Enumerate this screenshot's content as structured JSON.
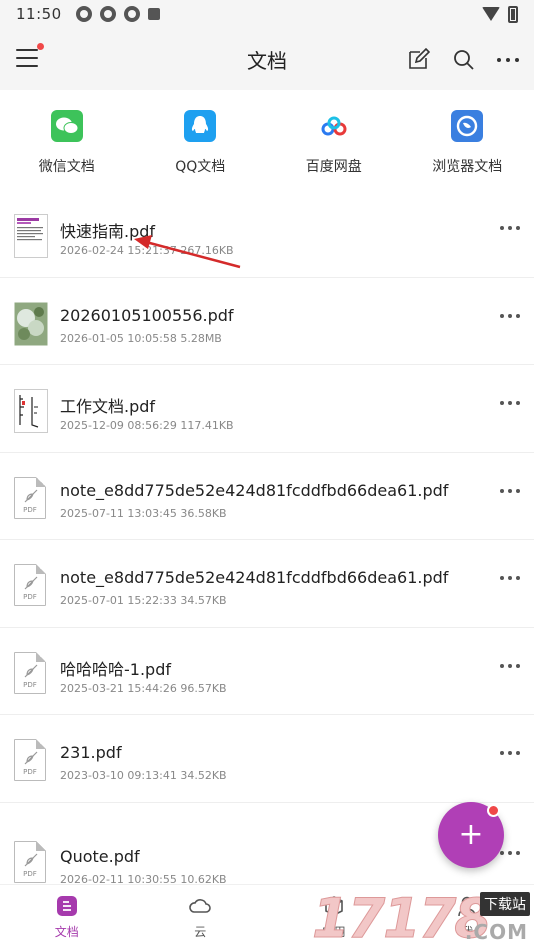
{
  "status": {
    "time": "11:50"
  },
  "header": {
    "title": "文档"
  },
  "sources": [
    {
      "label": "微信文档",
      "icon": "wechat-icon",
      "color": "#3dc35a"
    },
    {
      "label": "QQ文档",
      "icon": "qq-icon",
      "color": "#1ea0f0"
    },
    {
      "label": "百度网盘",
      "icon": "baidu-netdisk-icon",
      "color": "#2b7af0"
    },
    {
      "label": "浏览器文档",
      "icon": "browser-icon",
      "color": "#3a7fe0"
    }
  ],
  "files": [
    {
      "name": "快速指南.pdf",
      "meta": "2026-02-24 15:21:37 267.16KB",
      "thumb": "doc-preview"
    },
    {
      "name": "20260105100556.pdf",
      "meta": "2026-01-05 10:05:58 5.28MB",
      "thumb": "photo-preview"
    },
    {
      "name": "工作文档.pdf",
      "meta": "2025-12-09 08:56:29 117.41KB",
      "thumb": "doc-preview-2"
    },
    {
      "name": "note_e8dd775de52e424d81fcddfbd66dea61.pdf",
      "meta": "2025-07-11 13:03:45 36.58KB",
      "thumb": "pdf-icon"
    },
    {
      "name": "note_e8dd775de52e424d81fcddfbd66dea61.pdf",
      "meta": "2025-07-01 15:22:33 34.57KB",
      "thumb": "pdf-icon"
    },
    {
      "name": "哈哈哈哈-1.pdf",
      "meta": "2025-03-21 15:44:26 96.57KB",
      "thumb": "pdf-icon"
    },
    {
      "name": "231.pdf",
      "meta": "2023-03-10 09:13:41 34.52KB",
      "thumb": "pdf-icon"
    },
    {
      "name": "Quote.pdf",
      "meta": "2026-02-11 10:30:55 10.62KB",
      "thumb": "pdf-icon"
    }
  ],
  "pdf_label": "PDF",
  "fab": {
    "label": "+"
  },
  "nav": [
    {
      "label": "文档",
      "icon": "document-icon",
      "active": true
    },
    {
      "label": "云",
      "icon": "cloud-icon",
      "active": false
    },
    {
      "label": "应用",
      "icon": "apps-icon",
      "active": false
    },
    {
      "label": "我",
      "icon": "profile-icon",
      "active": false
    }
  ],
  "watermark": {
    "number": "17178",
    "site": "下载站",
    "domain": ".COM"
  },
  "colors": {
    "accent": "#a63aad",
    "fab": "#b03fb6",
    "badge": "#f04848",
    "arrow": "#d42a2a"
  }
}
